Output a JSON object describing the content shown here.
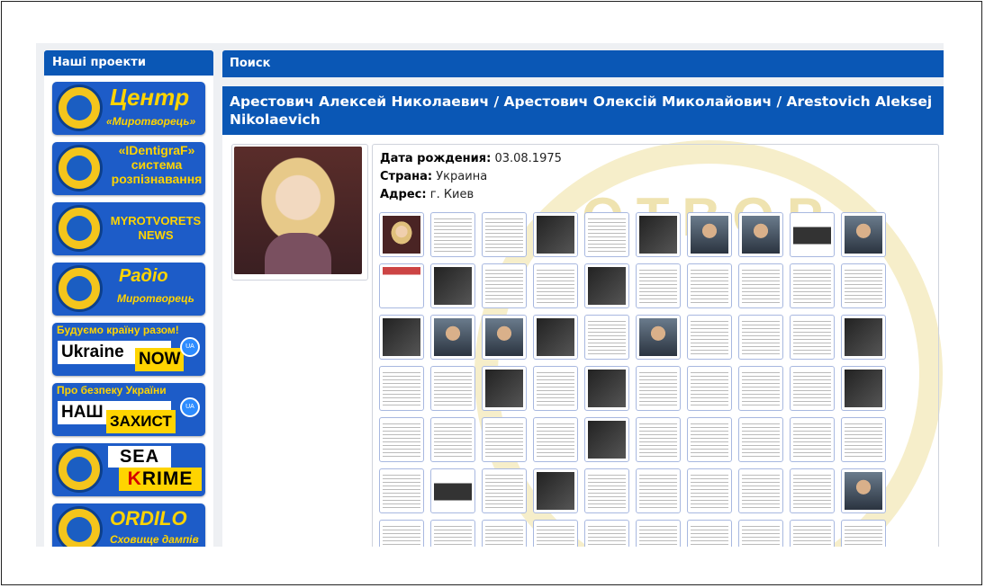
{
  "sidebar": {
    "heading": "Наші проекти",
    "banners": {
      "center": {
        "title": "Центр",
        "subtitle": "«Миротворець»"
      },
      "identigraf": {
        "title": "«IDentigraF» система розпізнавання"
      },
      "news": {
        "title": "MYROTVORETS NEWS"
      },
      "radio": {
        "title": "Радіо",
        "subtitle": "Миротворець"
      },
      "ukraine_now": {
        "top": "Будуємо країну разом!",
        "word1": "Ukraine",
        "word2": "NOW"
      },
      "nash_zakhyst": {
        "top": "Про безпеку України",
        "word1": "НАШ",
        "word2": "ЗАХИСТ"
      },
      "sea_krime": {
        "word1": "SEA",
        "word2_accent": "K",
        "word2_rest": "RIME"
      },
      "ordilo": {
        "title": "ORDILO",
        "subtitle": "Сховище дампів"
      }
    }
  },
  "header": {
    "search_label": "Поиск"
  },
  "person": {
    "title": "Арестович Алексей Николаевич / Арестович Олексій Миколайович / Arestovich Aleksej Nikolaevich",
    "birth_label": "Дата рождения:",
    "birth_value": "03.08.1975",
    "country_label": "Страна:",
    "country_value": "Украина",
    "address_label": "Адрес:",
    "address_value": "г. Киев"
  },
  "gallery": {
    "thumb_types": [
      "blond",
      "doc",
      "doc",
      "dark",
      "doc",
      "dark",
      "face",
      "face",
      "tw",
      "face",
      "mix",
      "dark",
      "doc",
      "doc",
      "dark",
      "doc",
      "doc",
      "doc",
      "doc",
      "doc",
      "dark",
      "face",
      "face",
      "dark",
      "doc",
      "face",
      "doc",
      "doc",
      "doc",
      "dark",
      "doc",
      "doc",
      "dark",
      "doc",
      "dark",
      "doc",
      "doc",
      "doc",
      "doc",
      "dark",
      "doc",
      "doc",
      "doc",
      "doc",
      "dark",
      "doc",
      "doc",
      "doc",
      "doc",
      "doc",
      "doc",
      "tw",
      "doc",
      "dark",
      "doc",
      "doc",
      "doc",
      "doc",
      "doc",
      "face",
      "doc",
      "doc",
      "doc",
      "doc",
      "doc",
      "doc",
      "doc",
      "doc",
      "doc",
      "doc"
    ]
  },
  "watermark": {
    "text": "ОТВОР"
  }
}
